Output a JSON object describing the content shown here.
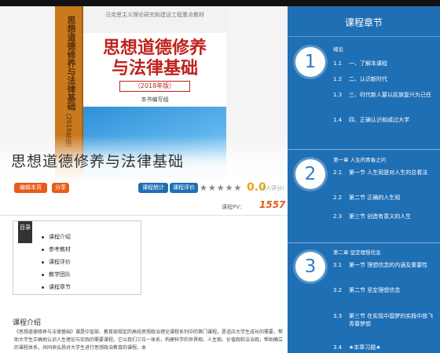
{
  "book": {
    "top_text": "马克思主义理论研究和建设工程重点教材",
    "title_line1": "思想道德修养",
    "title_line2": "与法律基础",
    "edition": "（2018年版）",
    "editor": "本书编写组",
    "spine_title": "思想道德修养与法律基础",
    "spine_sub": "（2018年版）"
  },
  "page": {
    "title": "思想道德修养与法律基础"
  },
  "actions": {
    "edit_label": "编辑本页",
    "share_label": "分享",
    "stats_label": "课程统计",
    "review_label": "课程评价",
    "stars": "★★★★★",
    "score": "0.0",
    "score_count": "(0人评分)",
    "pv_label": "课程PV：",
    "pv_value": "1557"
  },
  "toc": {
    "tag": "目录",
    "items": [
      "课程介绍",
      "参考教材",
      "课程评价",
      "教学团队",
      "课程章节"
    ]
  },
  "intro": {
    "title": "课程介绍",
    "text": "《思想道德修养与法律基础》课是中宣部、教育部规定的高校思想政治理论课程系列中的第门课程。是适应大学生成长的需要，帮助大学生正确地认识人生理论与实践的需要课程。它以我们三位一体系，构建科学的世界观、人生观、价值观和法治观，帮助确立的课程体系，共同来弘扬对大学生进行思想政治教育的课程。本"
  },
  "sidebar": {
    "title": "课程章节",
    "chapters": [
      {
        "num": "1",
        "head": "绪论",
        "lessons": [
          {
            "num": "1.1",
            "text": "一、了解本课程"
          },
          {
            "num": "1.2",
            "text": "二、认识新时代"
          },
          {
            "num": "1.3",
            "text": "三、时代新人要以民族复兴为己任"
          },
          {
            "num": "1.4",
            "text": "四、正确认识和成过大学"
          }
        ]
      },
      {
        "num": "2",
        "head": "第一章 人生的青春之问",
        "lessons": [
          {
            "num": "2.1",
            "text": "第一节 人生观是对人生的总看法"
          },
          {
            "num": "2.2",
            "text": "第二节 正确的人生观"
          },
          {
            "num": "2.3",
            "text": "第三节 创造有意义的人生"
          }
        ]
      },
      {
        "num": "3",
        "head": "第二章 坚定理想信念",
        "lessons": [
          {
            "num": "3.1",
            "text": "第一节 理想信念的内涵及重要性"
          },
          {
            "num": "3.2",
            "text": "第二节 坚定理想信念"
          },
          {
            "num": "3.3",
            "text": "第三节 在实现中国梦的实践中放飞青春梦想"
          },
          {
            "num": "3.4",
            "text": "★本章习题★"
          }
        ]
      }
    ]
  },
  "colors": {
    "sidebar_bg": "#1f6fb5",
    "accent_orange": "#e85b1a",
    "title_red": "#c0211c"
  }
}
